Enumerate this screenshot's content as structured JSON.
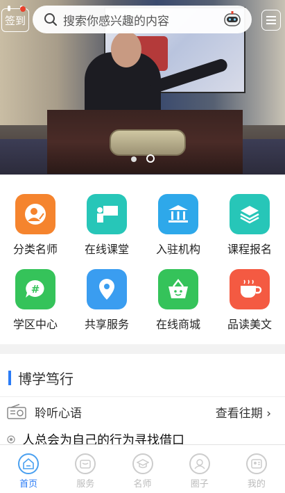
{
  "header": {
    "checkin_label": "签到",
    "search_placeholder": "搜索你感兴趣的内容",
    "icons": [
      "calendar-icon",
      "search-icon",
      "robot-icon",
      "menu-icon"
    ]
  },
  "banner": {
    "slide_count": 2,
    "active_slide": 2
  },
  "categories": [
    {
      "label": "分类名师",
      "icon": "teacher-icon",
      "color": "#f5842e"
    },
    {
      "label": "在线课堂",
      "icon": "classroom-icon",
      "color": "#27c6b8"
    },
    {
      "label": "入驻机构",
      "icon": "institution-icon",
      "color": "#2ea8ea"
    },
    {
      "label": "课程报名",
      "icon": "layers-icon",
      "color": "#27c6b8"
    },
    {
      "label": "学区中心",
      "icon": "hashtag-chat-icon",
      "color": "#35c35a"
    },
    {
      "label": "共享服务",
      "icon": "location-pin-icon",
      "color": "#3a9df0"
    },
    {
      "label": "在线商城",
      "icon": "basket-icon",
      "color": "#35c35a"
    },
    {
      "label": "品读美文",
      "icon": "coffee-cup-icon",
      "color": "#f45a42"
    }
  ],
  "section": {
    "title": "博学笃行",
    "listen_label": "聆听心语",
    "more_label": "查看往期 ›",
    "quote": "人总会为自己的行为寻找借口"
  },
  "tabbar": {
    "tabs": [
      {
        "label": "首页",
        "icon": "home-icon",
        "active": true
      },
      {
        "label": "服务",
        "icon": "service-icon",
        "active": false
      },
      {
        "label": "名师",
        "icon": "graduation-cap-icon",
        "active": false
      },
      {
        "label": "圈子",
        "icon": "community-icon",
        "active": false
      },
      {
        "label": "我的",
        "icon": "profile-card-icon",
        "active": false
      }
    ]
  },
  "colors": {
    "accent": "#2b7cf6",
    "inactive": "#bbbbbb"
  }
}
